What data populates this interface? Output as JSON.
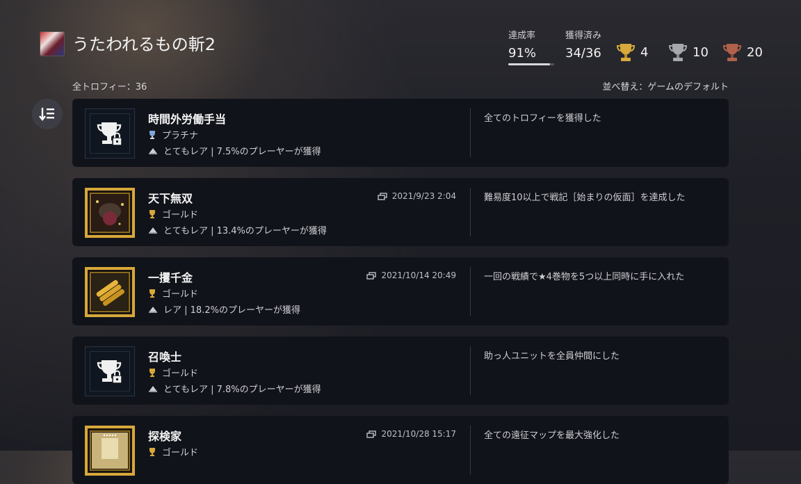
{
  "header": {
    "game_title": "うたわれるもの斬2",
    "game_icon": "game-cover-icon"
  },
  "stats": {
    "completion_label": "達成率",
    "completion_value": "91%",
    "completion_fraction": 0.91,
    "earned_label": "獲得済み",
    "earned_value": "34/36",
    "gold_count": "4",
    "silver_count": "10",
    "bronze_count": "20"
  },
  "list_header": {
    "total": "全トロフィー：36",
    "sort": "並べ替え：ゲームのデフォルト"
  },
  "colors": {
    "gold": "#d7a83a",
    "silver": "#a7a8ad",
    "bronze": "#b0614a",
    "platinum": "#7fa6d6",
    "card_bg": "#11131a"
  },
  "trophies": [
    {
      "name": "時間外労働手当",
      "grade": "プラチナ",
      "rarity": "とてもレア | 7.5%のプレーヤーが獲得",
      "date": "",
      "description": "全てのトロフィーを獲得した",
      "earned": false
    },
    {
      "name": "天下無双",
      "grade": "ゴールド",
      "rarity": "とてもレア | 13.4%のプレーヤーが獲得",
      "date": "2021/9/23  2:04",
      "description": "難易度10以上で戦記［始まりの仮面］を達成した",
      "earned": true
    },
    {
      "name": "一攫千金",
      "grade": "ゴールド",
      "rarity": "レア | 18.2%のプレーヤーが獲得",
      "date": "2021/10/14  20:49",
      "description": "一回の戦績で★4巻物を5つ以上同時に手に入れた",
      "earned": true
    },
    {
      "name": "召喚士",
      "grade": "ゴールド",
      "rarity": "とてもレア | 7.8%のプレーヤーが獲得",
      "date": "",
      "description": "助っ人ユニットを全員仲間にした",
      "earned": false
    },
    {
      "name": "探検家",
      "grade": "ゴールド",
      "rarity": "",
      "date": "2021/10/28  15:17",
      "description": "全ての遠征マップを最大強化した",
      "earned": true
    }
  ]
}
